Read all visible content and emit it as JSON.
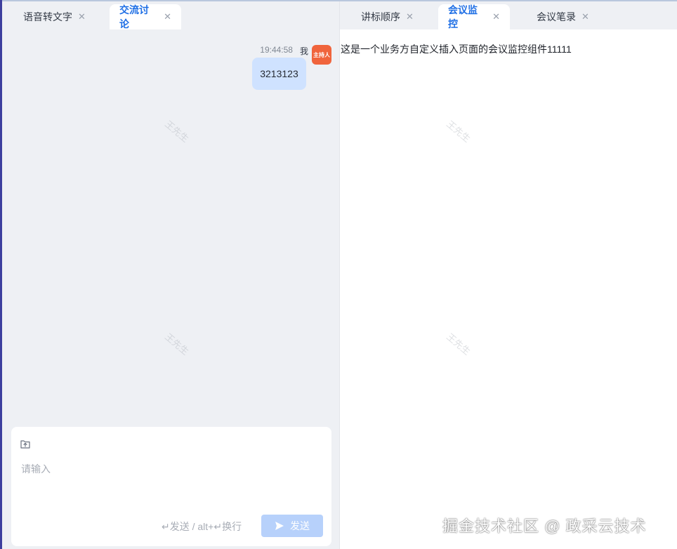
{
  "left_panel": {
    "tabs": [
      {
        "label": "语音转文字",
        "active": false
      },
      {
        "label": "交流讨论",
        "active": true
      }
    ],
    "messages": [
      {
        "time": "19:44:58",
        "sender": "我",
        "avatar_text": "主持人",
        "text": "3213123"
      }
    ],
    "composer": {
      "placeholder": "请输入",
      "hint": "↵发送 / alt+↵换行",
      "send_label": "发送"
    }
  },
  "right_panel": {
    "tabs": [
      {
        "label": "讲标顺序",
        "active": false
      },
      {
        "label": "会议监控",
        "active": true
      },
      {
        "label": "会议笔录",
        "active": false
      }
    ],
    "content_text": "这是一个业务方自定义插入页面的会议监控组件11111"
  },
  "watermark_text": "王先生",
  "footer_brand": "掘金技术社区 @ 政采云技术",
  "colors": {
    "accent": "#1f6fe5",
    "avatar_bg": "#f0643c",
    "bubble_bg": "#cfe2ff",
    "send_bg": "#b7d1fb"
  },
  "icons": [
    "close-icon",
    "upload-icon",
    "send-icon"
  ]
}
